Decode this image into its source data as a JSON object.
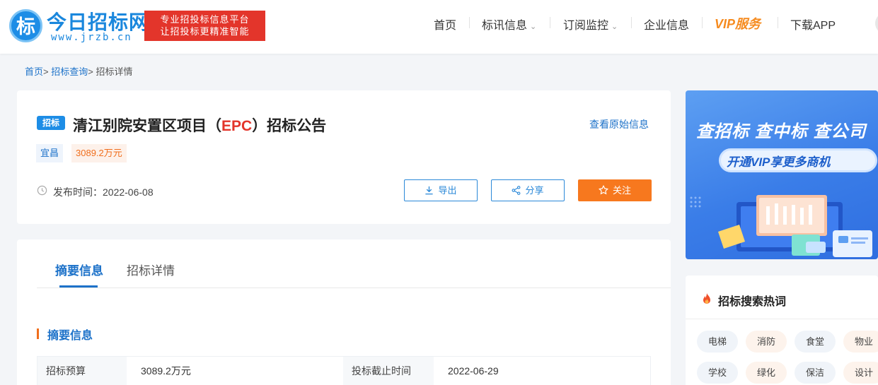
{
  "header": {
    "logo_char": "标",
    "logo_name": "今日招标网",
    "logo_url": "www.jrzb.cn",
    "slogan_line1": "专业招投标信息平台",
    "slogan_line2": "让招投标更精准智能",
    "nav": [
      {
        "label": "首页"
      },
      {
        "label": "标讯信息",
        "dropdown": "⌄"
      },
      {
        "label": "订阅监控",
        "dropdown": "⌄"
      },
      {
        "label": "企业信息"
      },
      {
        "label": "VIP服务"
      },
      {
        "label": "下载APP"
      }
    ]
  },
  "breadcrumb": {
    "home": "首页",
    "sep": ">",
    "search": "招标查询",
    "current": "招标详情"
  },
  "title_card": {
    "tag": "招标",
    "title_pre": "清江别院安置区项目（",
    "title_epc": "EPC",
    "title_post": "）招标公告",
    "view_original": "查看原始信息",
    "region": "宜昌",
    "amount": "3089.2万元",
    "publish_label": "发布时间：",
    "publish_date": "2022-06-08",
    "buttons": {
      "export": "导出",
      "share": "分享",
      "follow": "关注"
    }
  },
  "detail": {
    "tabs": [
      "摘要信息",
      "招标详情"
    ],
    "active_tab": "摘要信息",
    "section_title": "摘要信息",
    "row": {
      "budget_label": "招标预算",
      "budget_value": "3089.2万元",
      "deadline_label": "投标截止时间",
      "deadline_value": "2022-06-29"
    }
  },
  "banner": {
    "line1": "查招标 查中标 查公司",
    "line2": "开通VIP享更多商机"
  },
  "hot_search": {
    "title": "招标搜索热词",
    "tags": [
      "电梯",
      "消防",
      "食堂",
      "物业",
      "学校",
      "绿化",
      "保洁",
      "设计"
    ]
  },
  "colors": {
    "brand_blue": "#1d8de6",
    "link_blue": "#1d72c9",
    "accent_orange": "#f7781e",
    "red": "#e3352b"
  }
}
